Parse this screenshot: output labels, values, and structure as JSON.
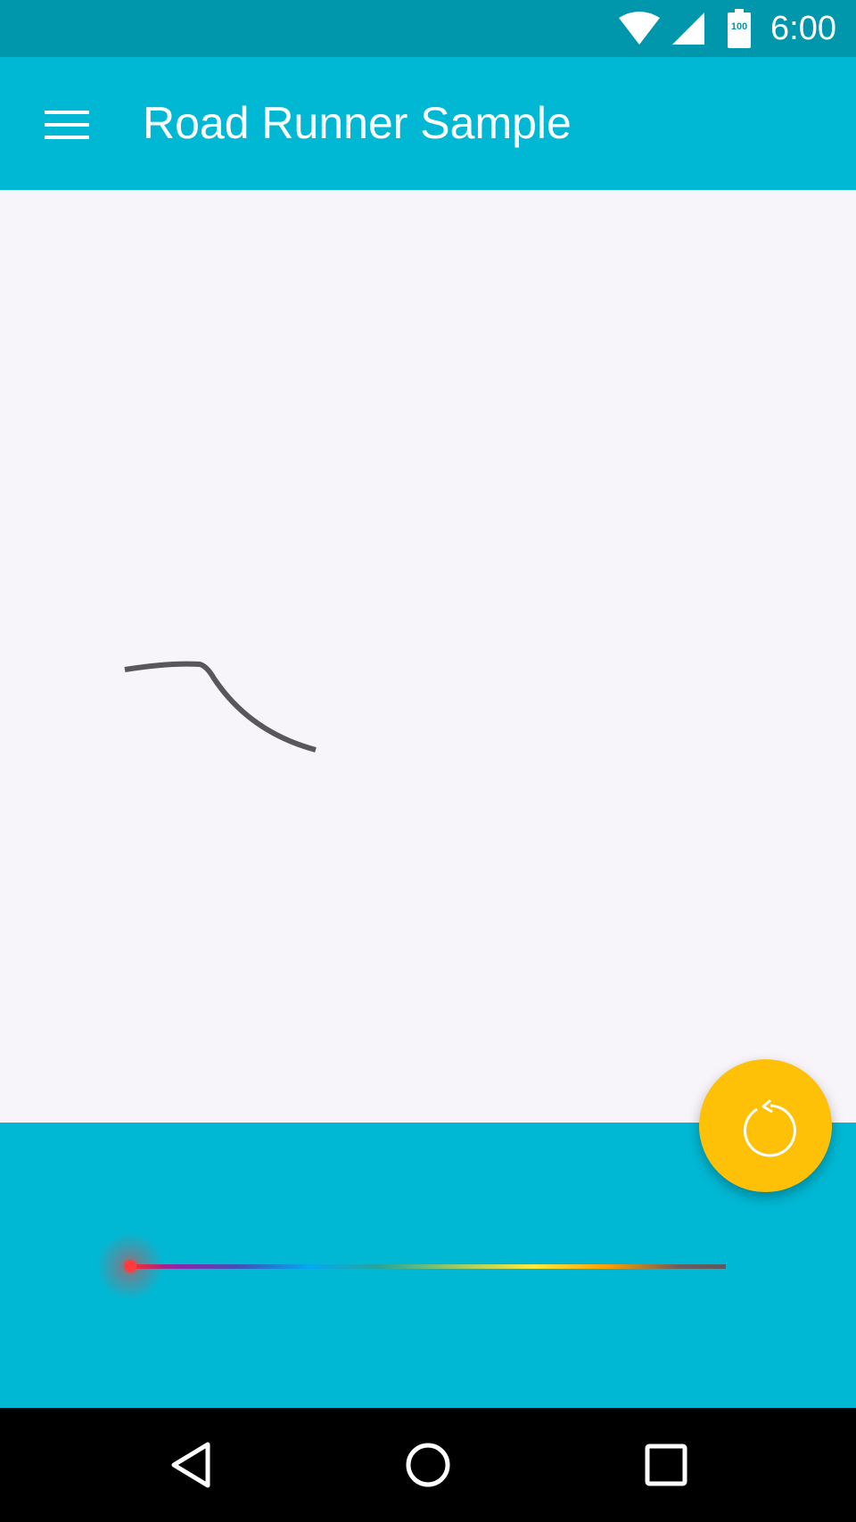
{
  "status_bar": {
    "time": "6:00",
    "battery_level": "100",
    "icons": [
      "wifi-icon",
      "cell-signal-icon",
      "battery-icon"
    ]
  },
  "app_bar": {
    "title": "Road Runner Sample",
    "menu_icon": "hamburger-menu-icon"
  },
  "fab": {
    "icon": "replay-icon"
  },
  "nav_bar": {
    "icons": [
      "back-icon",
      "home-icon",
      "recents-icon"
    ]
  },
  "colors": {
    "status_bar": "#0097AC",
    "app_bar": "#00B8D4",
    "canvas_bg": "#F7F5FA",
    "fab": "#FFC107",
    "stroke": "#58575C",
    "progress_dot": "#FF3B3B"
  }
}
